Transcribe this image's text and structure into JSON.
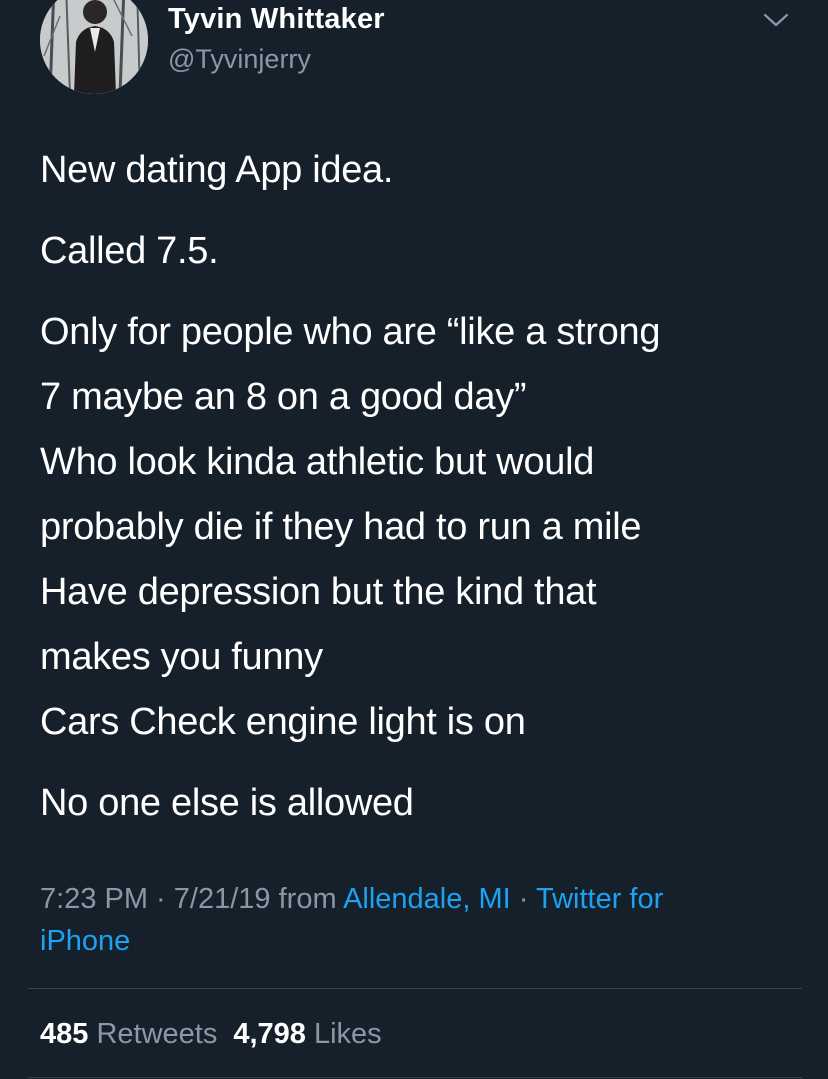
{
  "author": {
    "display_name": "Tyvin Whittaker",
    "handle": "@Tyvinjerry"
  },
  "icons": {
    "more_menu": "chevron-down-icon",
    "avatar": "profile-photo"
  },
  "tweet": {
    "paragraphs": [
      [
        "New dating App idea."
      ],
      [
        "Called 7.5."
      ],
      [
        "Only for people who are “like a strong",
        "7 maybe an 8 on a good day”",
        "Who look kinda athletic but would",
        "probably die if they had to run a mile",
        "Have depression but the kind that",
        "makes you funny",
        "Cars Check engine light is on"
      ],
      [
        "No one else is allowed"
      ]
    ]
  },
  "meta": {
    "time": "7:23 PM",
    "separator": " · ",
    "date": "7/21/19",
    "from_label": " from ",
    "location": "Allendale, MI",
    "source_line1": "Twitter for",
    "source_line2": "iPhone"
  },
  "stats": {
    "retweets_count": "485",
    "retweets_label": "Retweets",
    "likes_count": "4,798",
    "likes_label": "Likes"
  },
  "colors": {
    "background": "#15202b",
    "text_primary": "#ffffff",
    "text_secondary": "#8899a6",
    "link": "#1da1f2",
    "divider": "#38444d"
  }
}
